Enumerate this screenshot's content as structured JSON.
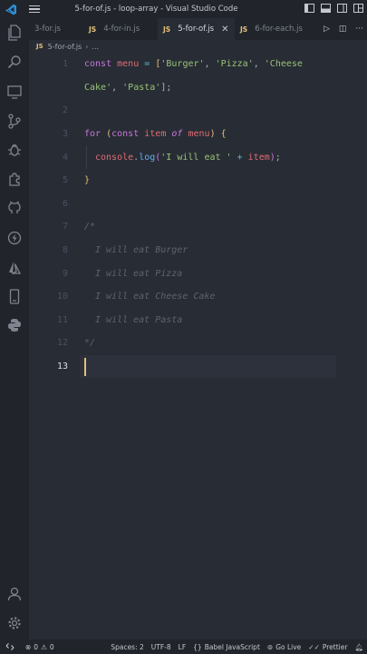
{
  "window": {
    "title": "5-for-of.js - loop-array - Visual Studio Code"
  },
  "tabs": [
    {
      "label": "3-for.js",
      "language": "",
      "active": false
    },
    {
      "label": "4-for-in.js",
      "language": "JS",
      "active": false
    },
    {
      "label": "5-for-of.js",
      "language": "JS",
      "active": true
    },
    {
      "label": "6-for-each.js",
      "language": "JS",
      "active": false
    }
  ],
  "breadcrumb": {
    "language": "JS",
    "file": "5-for-of.js",
    "more": "..."
  },
  "editor": {
    "current_line": "13",
    "line_numbers": [
      "1",
      "",
      "2",
      "3",
      "4",
      "5",
      "6",
      "7",
      "8",
      "9",
      "10",
      "11",
      "12",
      "13"
    ],
    "code": {
      "l1_const": "const",
      "l1_menu": "menu",
      "l1_eq": "=",
      "l1_open": "[",
      "l1_s1": "'Burger'",
      "l1_s2": "'Pizza'",
      "l1_s3a": "'Cheese",
      "l1_s3b": "Cake'",
      "l1_s4": "'Pasta'",
      "l1_close": "];",
      "l3_for": "for",
      "l3_const": "const",
      "l3_item": "item",
      "l3_of": "of",
      "l3_menu": "menu",
      "l3_brace": "{",
      "l4_console": "console",
      "l4_log": "log",
      "l4_str": "'I will eat '",
      "l4_plus": "+",
      "l4_item": "item",
      "l5_brace": "}",
      "c_open": "/*",
      "c1": "I will eat Burger",
      "c2": "I will eat Pizza",
      "c3": "I will eat Cheese Cake",
      "c4": "I will eat Pasta",
      "c_close": "*/"
    }
  },
  "statusbar": {
    "errors": "0",
    "warnings": "0",
    "spaces": "Spaces: 2",
    "encoding": "UTF-8",
    "eol": "LF",
    "language_braces": "{}",
    "language": "Babel JavaScript",
    "golive": "Go Live",
    "prettier": "Prettier"
  },
  "colors": {
    "background": "#282c34",
    "chrome": "#21252b",
    "keyword": "#c678dd",
    "variable": "#e06c75",
    "string": "#98c379",
    "function": "#61afef",
    "comment": "#5c6370"
  }
}
